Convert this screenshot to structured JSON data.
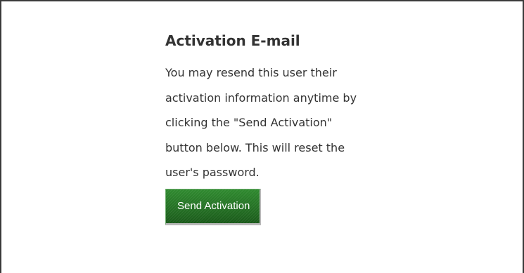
{
  "section": {
    "title": "Activation E-mail",
    "description": "You may resend this user their\nactivation information anytime by\nclicking the \"Send Activation\"\nbutton below. This will reset the\nuser's password."
  },
  "actions": {
    "send_activation_label": "Send Activation"
  },
  "colors": {
    "button_green": "#247024",
    "text": "#333333",
    "border": "#3a3a3a"
  }
}
